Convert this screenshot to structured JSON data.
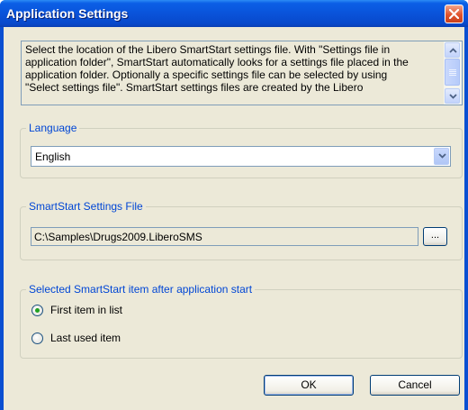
{
  "window": {
    "title": "Application Settings"
  },
  "description": {
    "lines": [
      "Select the location of the Libero SmartStart settings file. With \"Settings file in",
      "application folder\", SmartStart automatically looks for a settings file placed in the",
      "application folder. Optionally a specific settings file can be selected by using",
      "\"Select settings file\". SmartStart settings files are created by the Libero"
    ]
  },
  "language": {
    "group_label": "Language",
    "selected": "English"
  },
  "settings_file": {
    "group_label": "SmartStart Settings File",
    "path": "C:\\Samples\\Drugs2009.LiberoSMS",
    "browse_label": "..."
  },
  "start_item": {
    "group_label": "Selected SmartStart item after application start",
    "options": [
      {
        "label": "First item in list",
        "selected": true
      },
      {
        "label": "Last used item",
        "selected": false
      }
    ]
  },
  "buttons": {
    "ok": "OK",
    "cancel": "Cancel"
  },
  "colors": {
    "title_bar": "#0a53da",
    "group_label": "#0046d5",
    "dialog_bg": "#ece9d8",
    "close_button": "#e0532c",
    "radio_dot": "#21a121"
  }
}
